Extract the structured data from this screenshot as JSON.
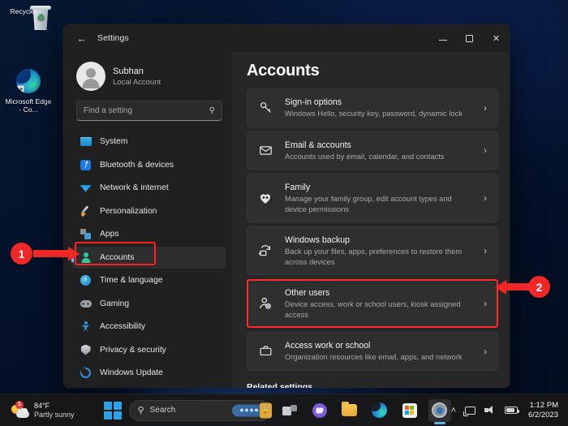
{
  "desktop": {
    "icons": [
      {
        "name": "Recycle Bin",
        "icon": "recycle-bin-icon"
      },
      {
        "name": "Microsoft Edge - Co...",
        "icon": "microsoft-edge-icon"
      }
    ]
  },
  "window": {
    "titlebar": {
      "back_label": "←",
      "title": "Settings",
      "minimize_label": "",
      "maximize_label": "",
      "close_label": "✕"
    },
    "profile": {
      "name": "Subhan",
      "account_type": "Local Account"
    },
    "search": {
      "placeholder": "Find a setting",
      "value": "",
      "icon": "search-icon"
    },
    "nav": {
      "items": [
        {
          "label": "System",
          "icon": "system-icon",
          "selected": false
        },
        {
          "label": "Bluetooth & devices",
          "icon": "bluetooth-icon",
          "selected": false
        },
        {
          "label": "Network & internet",
          "icon": "wifi-icon",
          "selected": false
        },
        {
          "label": "Personalization",
          "icon": "paintbrush-icon",
          "selected": false
        },
        {
          "label": "Apps",
          "icon": "apps-icon",
          "selected": false
        },
        {
          "label": "Accounts",
          "icon": "accounts-icon",
          "selected": true
        },
        {
          "label": "Time & language",
          "icon": "clock-icon",
          "selected": false
        },
        {
          "label": "Gaming",
          "icon": "gamepad-icon",
          "selected": false
        },
        {
          "label": "Accessibility",
          "icon": "accessibility-icon",
          "selected": false
        },
        {
          "label": "Privacy & security",
          "icon": "shield-icon",
          "selected": false
        },
        {
          "label": "Windows Update",
          "icon": "update-icon",
          "selected": false
        }
      ]
    },
    "main": {
      "page_title": "Accounts",
      "cards": [
        {
          "title": "Sign-in options",
          "subtitle": "Windows Hello, security key, password, dynamic lock",
          "icon": "key-icon",
          "highlighted": false
        },
        {
          "title": "Email & accounts",
          "subtitle": "Accounts used by email, calendar, and contacts",
          "icon": "envelope-icon",
          "highlighted": false
        },
        {
          "title": "Family",
          "subtitle": "Manage your family group, edit account types and device permissions",
          "icon": "family-heart-icon",
          "highlighted": false
        },
        {
          "title": "Windows backup",
          "subtitle": "Back up your files, apps, preferences to restore them across devices",
          "icon": "backup-sync-icon",
          "highlighted": false
        },
        {
          "title": "Other users",
          "subtitle": "Device access, work or school users, kiosk assigned access",
          "icon": "add-user-icon",
          "highlighted": true
        },
        {
          "title": "Access work or school",
          "subtitle": "Organization resources like email, apps, and network",
          "icon": "briefcase-icon",
          "highlighted": false
        }
      ],
      "chevron": "›",
      "related_settings": "Related settings"
    }
  },
  "annotations": [
    {
      "number": "1",
      "target": "accounts-nav-item"
    },
    {
      "number": "2",
      "target": "other-users-card"
    }
  ],
  "taskbar": {
    "weather": {
      "temperature": "84°F",
      "condition": "Partly sunny",
      "notification_count": "1",
      "icon": "partly-sunny-icon"
    },
    "start": {
      "label": "",
      "icon": "windows-start-icon"
    },
    "search": {
      "placeholder": "Search",
      "icon": "search-icon"
    },
    "apps": [
      {
        "name": "Task View",
        "icon": "task-view-icon"
      },
      {
        "name": "Microsoft Teams",
        "icon": "teams-icon"
      },
      {
        "name": "File Explorer",
        "icon": "file-explorer-icon"
      },
      {
        "name": "Microsoft Edge",
        "icon": "edge-icon"
      },
      {
        "name": "Microsoft Store",
        "icon": "store-icon"
      },
      {
        "name": "Settings",
        "icon": "settings-gear-icon",
        "active": true
      }
    ],
    "tray": {
      "chevron": "˄",
      "icons": [
        "network-icon",
        "volume-icon",
        "battery-icon"
      ],
      "time": "1:12 PM",
      "date": "6/2/2023"
    }
  },
  "colors": {
    "accent": "#4cc2ff",
    "annotation": "#ff2121",
    "window_bg": "#202020",
    "main_bg": "#272727",
    "card_bg": "#2f2f2f"
  }
}
